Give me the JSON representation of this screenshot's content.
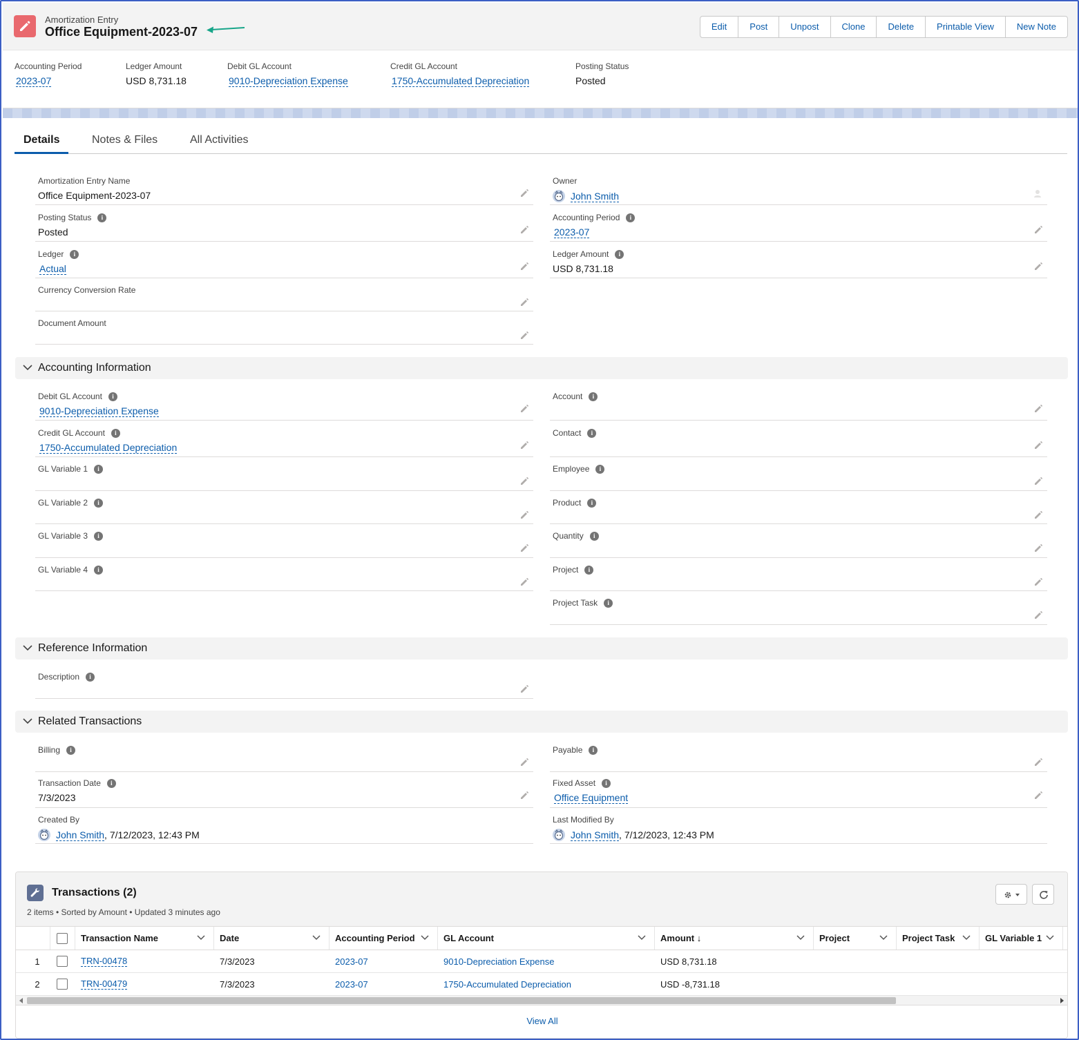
{
  "header": {
    "object_type": "Amortization Entry",
    "record_title": "Office Equipment-2023-07",
    "buttons": [
      "Edit",
      "Post",
      "Unpost",
      "Clone",
      "Delete",
      "Printable View",
      "New Note"
    ],
    "highlights": [
      {
        "label": "Accounting Period",
        "value": "2023-07",
        "link": true
      },
      {
        "label": "Ledger Amount",
        "value": "USD 8,731.18",
        "link": false
      },
      {
        "label": "Debit GL Account",
        "value": "9010-Depreciation Expense",
        "link": true
      },
      {
        "label": "Credit GL Account",
        "value": "1750-Accumulated Depreciation",
        "link": true
      },
      {
        "label": "Posting Status",
        "value": "Posted",
        "link": false
      }
    ]
  },
  "tabs": [
    "Details",
    "Notes & Files",
    "All Activities"
  ],
  "details": {
    "entry_name_label": "Amortization Entry Name",
    "entry_name_value": "Office Equipment-2023-07",
    "posting_status_label": "Posting Status",
    "posting_status_value": "Posted",
    "ledger_label": "Ledger",
    "ledger_value": "Actual",
    "conv_rate_label": "Currency Conversion Rate",
    "doc_amount_label": "Document Amount",
    "owner_label": "Owner",
    "owner_value": "John Smith",
    "acct_period_label": "Accounting Period",
    "acct_period_value": "2023-07",
    "ledger_amount_label": "Ledger Amount",
    "ledger_amount_value": "USD 8,731.18"
  },
  "accounting": {
    "title": "Accounting Information",
    "debit_label": "Debit GL Account",
    "debit_value": "9010-Depreciation Expense",
    "credit_label": "Credit GL Account",
    "credit_value": "1750-Accumulated Depreciation",
    "glv1": "GL Variable 1",
    "glv2": "GL Variable 2",
    "glv3": "GL Variable 3",
    "glv4": "GL Variable 4",
    "account": "Account",
    "contact": "Contact",
    "employee": "Employee",
    "product": "Product",
    "quantity": "Quantity",
    "project": "Project",
    "project_task": "Project Task"
  },
  "reference": {
    "title": "Reference Information",
    "description_label": "Description"
  },
  "related": {
    "title": "Related Transactions",
    "billing_label": "Billing",
    "payable_label": "Payable",
    "txn_date_label": "Transaction Date",
    "txn_date_value": "7/3/2023",
    "fixed_asset_label": "Fixed Asset",
    "fixed_asset_value": "Office Equipment",
    "created_by_label": "Created By",
    "created_by_name": "John Smith",
    "created_by_date": ", 7/12/2023, 12:43 PM",
    "modified_by_label": "Last Modified By",
    "modified_by_name": "John Smith",
    "modified_by_date": ", 7/12/2023, 12:43 PM"
  },
  "transactions": {
    "title": "Transactions (2)",
    "subtitle": "2 items • Sorted by Amount • Updated 3 minutes ago",
    "columns": [
      "Transaction Name",
      "Date",
      "Accounting Period",
      "GL Account",
      "Amount",
      "Project",
      "Project Task",
      "GL Variable 1"
    ],
    "sort_indicator": "↓",
    "rows": [
      {
        "num": "1",
        "name": "TRN-00478",
        "date": "7/3/2023",
        "period": "2023-07",
        "gl": "9010-Depreciation Expense",
        "amount": "USD 8,731.18"
      },
      {
        "num": "2",
        "name": "TRN-00479",
        "date": "7/3/2023",
        "period": "2023-07",
        "gl": "1750-Accumulated Depreciation",
        "amount": "USD -8,731.18"
      }
    ],
    "view_all": "View All"
  },
  "colors": {
    "accent": "#0b5cab",
    "object_icon": "#e9696e",
    "related_icon": "#5f6f93"
  },
  "icons": {
    "object": "pencil-icon",
    "related_list": "wrench-icon",
    "settings": "gear-icon",
    "refresh": "refresh-icon",
    "edit": "pencil-icon",
    "info": "info-icon",
    "user": "avatar-icon"
  }
}
